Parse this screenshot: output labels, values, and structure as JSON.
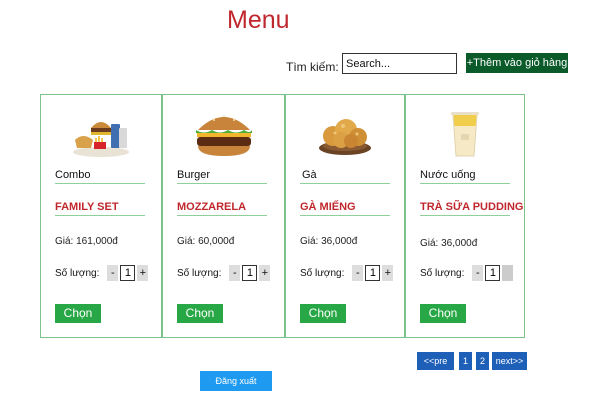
{
  "header": {
    "title": "Menu"
  },
  "search": {
    "label": "Tìm kiếm:",
    "placeholder": "Search...",
    "add_cart_label": "+Thêm vào giỏ hàng"
  },
  "products": [
    {
      "category": "Combo",
      "name": "FAMILY SET",
      "price": "Giá: 161,000đ",
      "qty_label": "Số lượng:",
      "qty": "1",
      "choose_label": "Chọn",
      "image_icon": "combo-meal-icon"
    },
    {
      "category": "Burger",
      "name": "MOZZARELA",
      "price": "Giá: 60,000đ",
      "qty_label": "Số lượng:",
      "qty": "1",
      "choose_label": "Chọn",
      "image_icon": "burger-icon"
    },
    {
      "category": "Gà",
      "name": "GÀ MIẾNG",
      "price": "Giá: 36,000đ",
      "qty_label": "Số lượng:",
      "qty": "1",
      "choose_label": "Chọn",
      "image_icon": "fried-chicken-icon"
    },
    {
      "category": "Nước uống",
      "name": "TRÀ SỮA PUDDING",
      "price": "Giá: 36,000đ",
      "qty_label": "Số lượng:",
      "qty": "1",
      "choose_label": "Chọn",
      "image_icon": "milk-tea-icon"
    }
  ],
  "qty_controls": {
    "minus": "-",
    "plus": "+"
  },
  "pagination": {
    "prev": "<<pre",
    "pages": [
      "1",
      "2"
    ],
    "next": "next>>"
  },
  "footer": {
    "logout_label": "Đăng xuất"
  },
  "colors": {
    "title": "#c0272d",
    "accent_green": "#27a745",
    "cart_button": "#0b5a2a",
    "pager": "#1e5fb8",
    "logout": "#1e9bf0",
    "card_border": "#7bc38b"
  }
}
